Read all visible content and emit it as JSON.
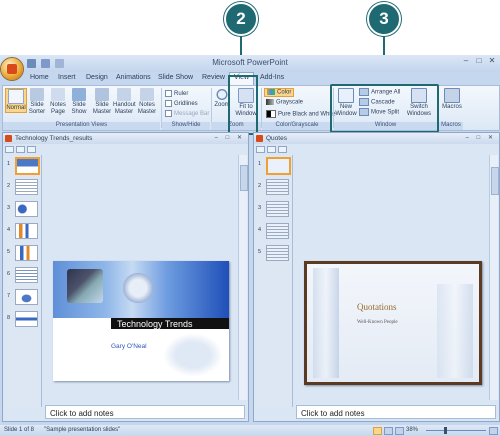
{
  "callouts": {
    "first": "2",
    "second": "3"
  },
  "window": {
    "title": "Microsoft PowerPoint"
  },
  "tabs": [
    "Home",
    "Insert",
    "Design",
    "Animations",
    "Slide Show",
    "Review",
    "View",
    "Add-Ins"
  ],
  "ribbon": {
    "presentation_views": {
      "label": "Presentation Views",
      "normal": "Normal",
      "slide_sorter": "Slide Sorter",
      "notes_page": "Notes Page",
      "slide_show": "Slide Show",
      "slide_master": "Slide Master",
      "handout_master": "Handout Master",
      "notes_master": "Notes Master"
    },
    "show_hide": {
      "label": "Show/Hide",
      "ruler": "Ruler",
      "gridlines": "Gridlines",
      "message_bar": "Message Bar"
    },
    "zoom": {
      "label": "Zoom",
      "zoom": "Zoom",
      "fit_to_window": "Fit to Window"
    },
    "color_grayscale": {
      "label": "Color/Grayscale",
      "color": "Color",
      "grayscale": "Grayscale",
      "pure_bw": "Pure Black and White"
    },
    "window": {
      "label": "Window",
      "new_window": "New Window",
      "arrange_all": "Arrange All",
      "cascade": "Cascade",
      "move_split": "Move Split",
      "switch_windows": "Switch Windows"
    },
    "macros": {
      "label": "Macros",
      "macros": "Macros"
    }
  },
  "left_window": {
    "title": "Technology Trends_results",
    "slide_title": "Technology Trends",
    "slide_subtitle": "Gary O'Neal",
    "thumb_numbers": [
      "1",
      "2",
      "3",
      "4",
      "5",
      "6",
      "7",
      "8"
    ],
    "notes": "Click to add notes"
  },
  "right_window": {
    "title": "Quotes",
    "slide_title": "Quotations",
    "slide_subtitle": "Well-Known People",
    "thumb_numbers": [
      "1",
      "2",
      "3",
      "4",
      "5"
    ],
    "notes": "Click to add notes"
  },
  "status": {
    "slide": "Slide 1 of 8",
    "theme": "\"Sample presentation slides\"",
    "zoom": "38%"
  },
  "colors": {
    "callout": "#1f6a72",
    "accent_orange": "#f0a030",
    "tech_title_bar": "#111111"
  }
}
